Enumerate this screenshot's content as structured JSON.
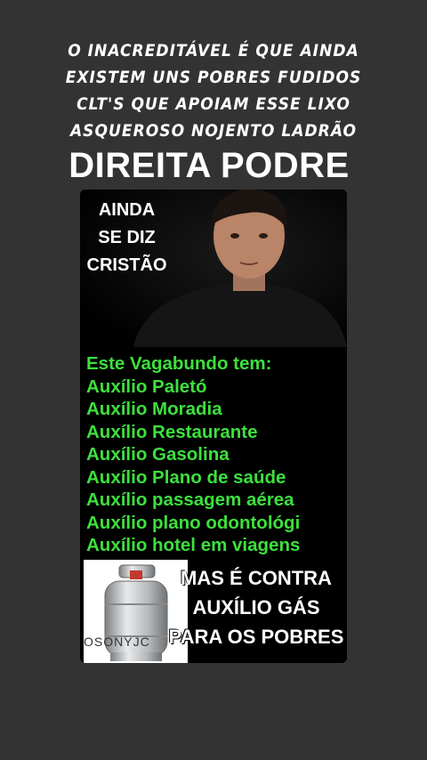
{
  "caption": {
    "lines": [
      "O INACREDITÁVEL É QUE AINDA",
      "EXISTEM UNS POBRES FUDIDOS",
      "CLT'S QUE APOIAM ESSE LIXO",
      "ASQUEROSO NOJENTO LADRÃO"
    ]
  },
  "headline": "DIREITA PODRE",
  "hero": {
    "lines": [
      "AINDA",
      "SE DIZ",
      "CRISTÃO"
    ]
  },
  "list": {
    "items": [
      "Este Vagabundo tem:",
      "Auxílio Paletó",
      "Auxílio Moradia",
      "Auxílio Restaurante",
      "Auxílio Gasolina",
      "Auxílio Plano de saúde",
      "Auxílio passagem aérea",
      "Auxílio plano odontológi",
      "Auxílio hotel em viagens"
    ]
  },
  "bottom": {
    "lines": [
      "MAS É CONTRA",
      "AUXÍLIO GÁS",
      "PARA OS POBRES"
    ],
    "watermark": "OSONYJC"
  },
  "colors": {
    "background": "#333333",
    "list_text": "#3de03d",
    "card": "#000000"
  }
}
